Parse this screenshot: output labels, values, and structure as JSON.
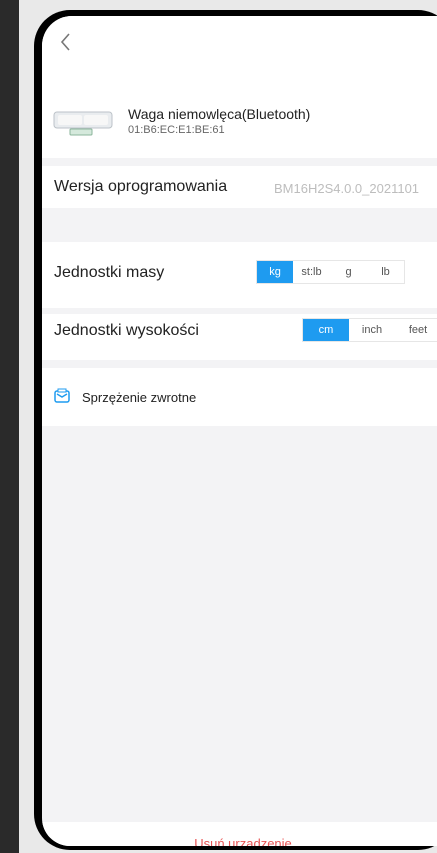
{
  "device": {
    "name": "Waga niemowlęca(Bluetooth)",
    "mac": "01:B6:EC:E1:BE:61"
  },
  "firmware": {
    "label": "Wersja oprogramowania",
    "value": "BM16H2S4.0.0_2021101"
  },
  "mass_units": {
    "label": "Jednostki masy",
    "options": [
      "kg",
      "st:lb",
      "g",
      "lb"
    ],
    "selected": "kg"
  },
  "height_units": {
    "label": "Jednostki wysokości",
    "options": [
      "cm",
      "inch",
      "feet"
    ],
    "selected": "cm"
  },
  "feedback": {
    "label": "Sprzężenie zwrotne",
    "icon": "feedback-icon"
  },
  "actions": {
    "delete_label": "Usuń urządzenie"
  },
  "colors": {
    "accent": "#1e9bf0",
    "danger": "#e85555"
  }
}
